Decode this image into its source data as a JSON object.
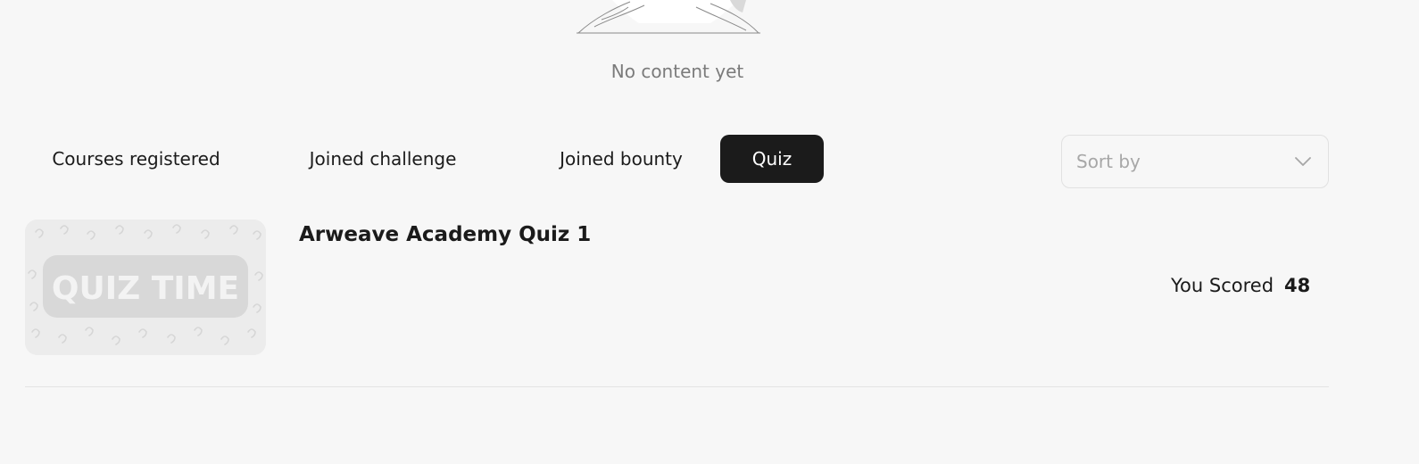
{
  "empty_state": {
    "message": "No content yet"
  },
  "tabs": [
    {
      "label": "Courses registered",
      "active": false
    },
    {
      "label": "Joined challenge",
      "active": false
    },
    {
      "label": "Joined bounty",
      "active": false
    },
    {
      "label": "Quiz",
      "active": true
    }
  ],
  "sort": {
    "placeholder": "Sort by"
  },
  "quizzes": [
    {
      "thumbnail_text": "QUIZ TIME",
      "title": "Arweave Academy Quiz 1",
      "score_label": "You Scored",
      "score": "48"
    }
  ],
  "colors": {
    "background": "#f7f7f7",
    "active_tab": "#1b1b1b",
    "muted_text": "#7b7b7b"
  }
}
